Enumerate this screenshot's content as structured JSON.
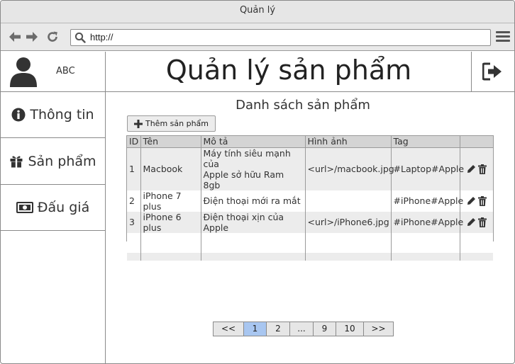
{
  "window": {
    "title": "Quản lý"
  },
  "browser": {
    "url": "http://"
  },
  "user": {
    "name": "ABC"
  },
  "sidebar": {
    "items": [
      {
        "label": "Thông tin",
        "icon": "info-icon"
      },
      {
        "label": "Sản phẩm",
        "icon": "gift-icon"
      },
      {
        "label": "Đấu giá",
        "icon": "money-icon"
      }
    ]
  },
  "header": {
    "title": "Quản lý sản phẩm"
  },
  "main": {
    "list_title": "Danh sách sản phẩm",
    "add_button": "Thêm sản phẩm",
    "table": {
      "columns": [
        "ID",
        "Tên",
        "Mô tả",
        "Hình ảnh",
        "Tag",
        ""
      ],
      "rows": [
        {
          "id": "1",
          "name": "Macbook",
          "desc_line1": "Máy tính siêu mạnh của",
          "desc_line2": "Apple sở hữu Ram 8gb",
          "image": "<url>/macbook.jpg",
          "tag": "#Laptop#Apple"
        },
        {
          "id": "2",
          "name": "iPhone 7 plus",
          "desc_line1": "Điện thoại mới ra mắt",
          "desc_line2": "",
          "image": "",
          "tag": "#iPhone#Apple"
        },
        {
          "id": "3",
          "name": "iPhone 6 plus",
          "desc_line1": "Điện thoại xịn của Apple",
          "desc_line2": "",
          "image": "<url>/iPhone6.jpg",
          "tag": "#iPhone#Apple"
        }
      ]
    }
  },
  "pagination": {
    "items": [
      "<<",
      "1",
      "2",
      "...",
      "9",
      "10",
      ">>"
    ],
    "active": "1"
  }
}
